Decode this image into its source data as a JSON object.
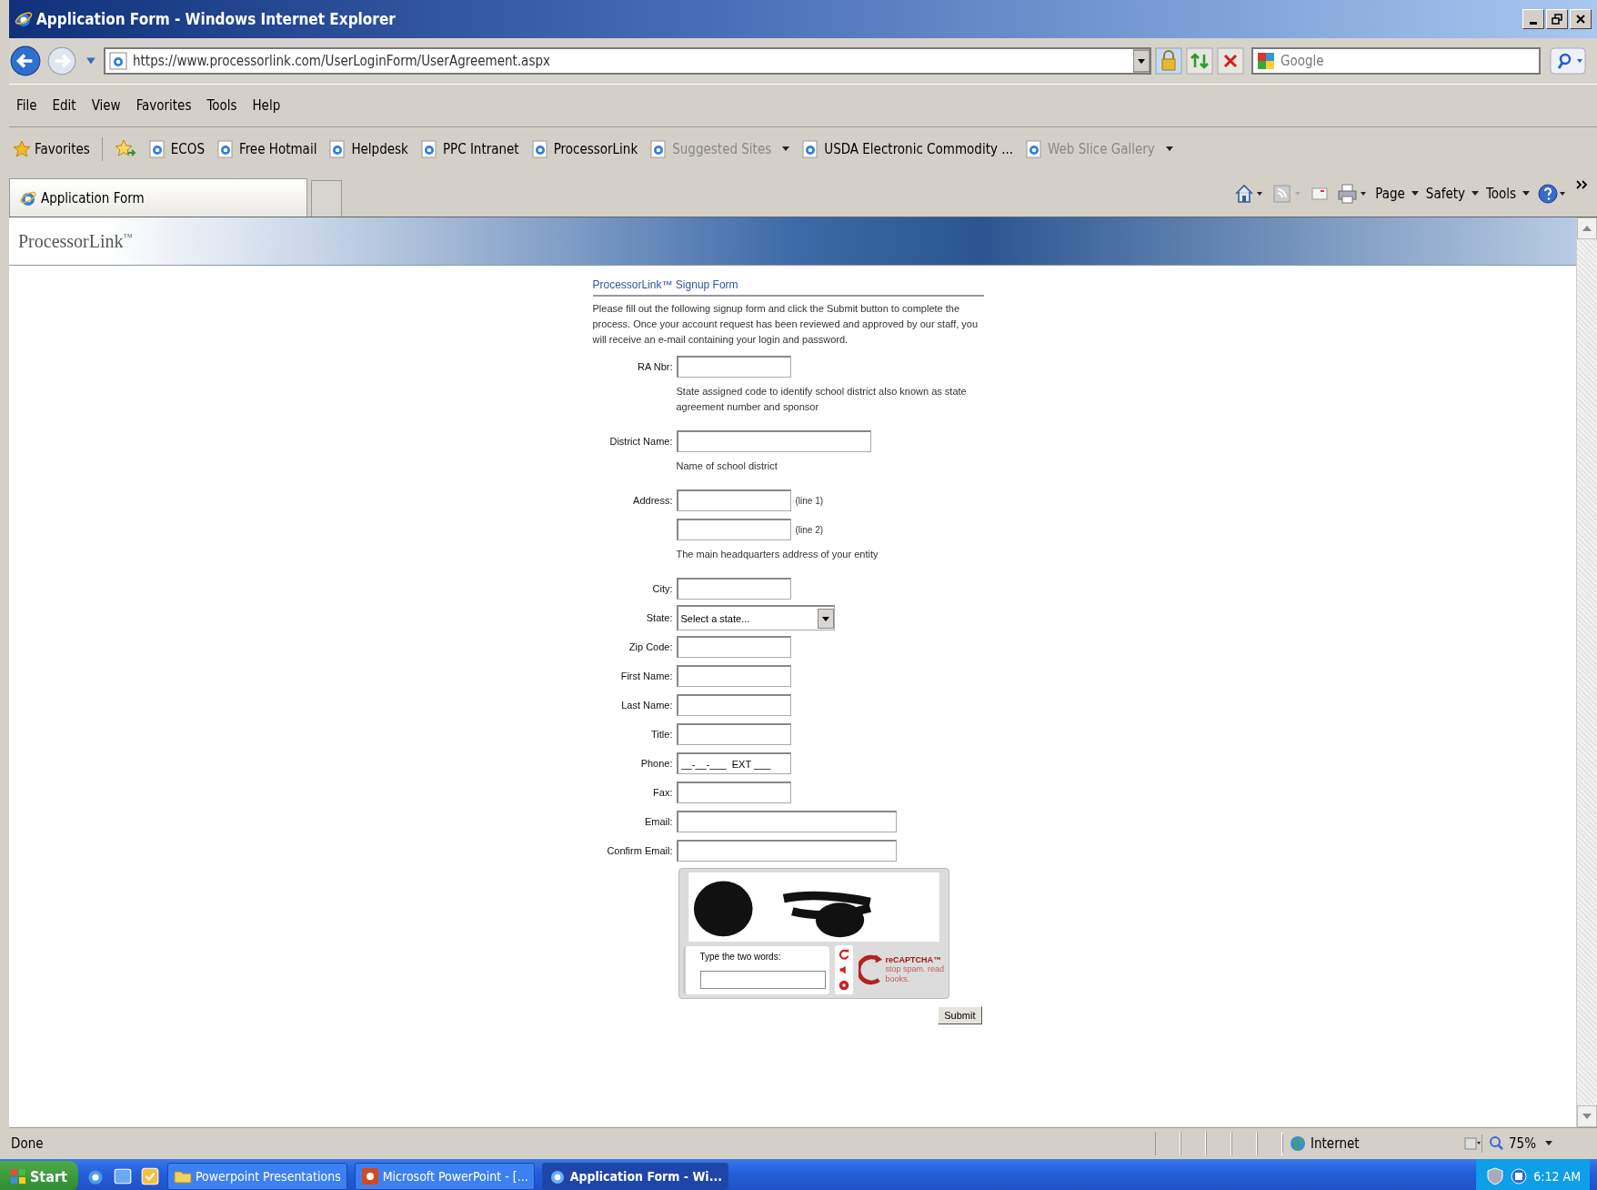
{
  "window": {
    "title": "Application Form - Windows Internet Explorer"
  },
  "address_bar": {
    "url": "https://www.processorlink.com/UserLoginForm/UserAgreement.aspx"
  },
  "search": {
    "placeholder": "Google"
  },
  "menu": [
    "File",
    "Edit",
    "View",
    "Favorites",
    "Tools",
    "Help"
  ],
  "favorites_bar": {
    "label": "Favorites",
    "items": [
      {
        "label": "ECOS",
        "disabled": false,
        "dropdown": false
      },
      {
        "label": "Free Hotmail",
        "disabled": false,
        "dropdown": false
      },
      {
        "label": "Helpdesk",
        "disabled": false,
        "dropdown": false
      },
      {
        "label": "PPC Intranet",
        "disabled": false,
        "dropdown": false
      },
      {
        "label": "ProcessorLink",
        "disabled": false,
        "dropdown": false
      },
      {
        "label": "Suggested Sites",
        "disabled": true,
        "dropdown": true
      },
      {
        "label": "USDA Electronic Commodity ...",
        "disabled": false,
        "dropdown": false
      },
      {
        "label": "Web Slice Gallery",
        "disabled": true,
        "dropdown": true
      }
    ]
  },
  "tabs": [
    {
      "label": "Application Form",
      "selected": true
    }
  ],
  "command_bar": [
    "Page",
    "Safety",
    "Tools"
  ],
  "page": {
    "logo": "ProcessorLink",
    "logo_mark": "™",
    "form": {
      "title": "ProcessorLink™ Signup Form",
      "intro": "Please fill out the following signup form and click the Submit button to complete the process. Once your account request has been reviewed and approved by our staff, you will receive an e-mail containing your login and password.",
      "fields": [
        {
          "kind": "short",
          "label": "RA Nbr:",
          "hint": "State assigned code to identify school district also known as state agreement number and sponsor"
        },
        {
          "kind": "medium",
          "label": "District Name:",
          "hint": "Name of school district"
        },
        {
          "kind": "short",
          "label": "Address:",
          "suffix": "(line 1)"
        },
        {
          "kind": "short",
          "suffix": "(line 2)",
          "hint": "The main headquarters address of your entity"
        },
        {
          "kind": "short",
          "label": "City:"
        },
        {
          "kind": "select",
          "label": "State:",
          "value": "Select a state..."
        },
        {
          "kind": "short",
          "label": "Zip Code:"
        },
        {
          "kind": "short",
          "label": "First Name:"
        },
        {
          "kind": "short",
          "label": "Last Name:"
        },
        {
          "kind": "short",
          "label": "Title:"
        },
        {
          "kind": "short",
          "label": "Phone:",
          "value": "__-__-___  EXT ___"
        },
        {
          "kind": "short",
          "label": "Fax:"
        },
        {
          "kind": "long",
          "label": "Email:"
        },
        {
          "kind": "long",
          "label": "Confirm Email:"
        }
      ],
      "captcha": {
        "prompt": "Type the two words:",
        "brand": "reCAPTCHA™",
        "tagline": "stop spam. read books."
      },
      "submit": "Submit"
    }
  },
  "status_bar": {
    "status": "Done",
    "zone": "Internet",
    "zoom": "75%"
  },
  "taskbar": {
    "start": "Start",
    "tasks": [
      {
        "label": "Powerpoint Presentations",
        "kind": "folder",
        "selected": false
      },
      {
        "label": "Microsoft PowerPoint - [...",
        "kind": "powerpoint",
        "selected": false
      },
      {
        "label": "Application Form - Wi...",
        "kind": "browser",
        "selected": true
      }
    ],
    "clock": "6:12 AM"
  }
}
